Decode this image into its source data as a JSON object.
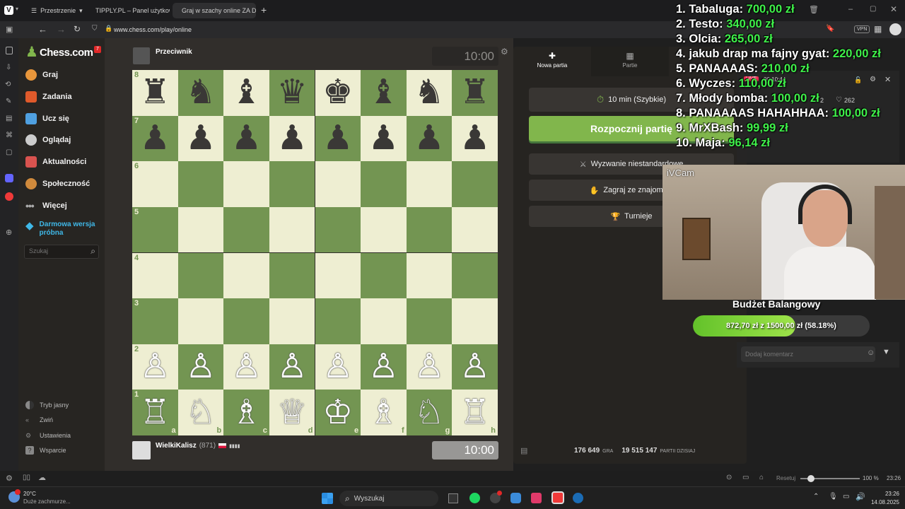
{
  "browser": {
    "spaces_label": "Przestrzenie",
    "tabs": [
      {
        "label": "TIPPLY.PL – Panel użytkown"
      },
      {
        "label": "Graj w szachy online ZA DA"
      }
    ],
    "url": "www.chess.com/play/online",
    "vpn": "VPN"
  },
  "sidebar": {
    "logo": "Chess.com",
    "notif_count": "7",
    "items": [
      {
        "label": "Graj",
        "color": "#e8963b"
      },
      {
        "label": "Zadania",
        "color": "#e05a2b"
      },
      {
        "label": "Ucz się",
        "color": "#4fa0e0"
      },
      {
        "label": "Oglądaj",
        "color": "#cccccc"
      },
      {
        "label": "Aktualności",
        "color": "#d9534f"
      },
      {
        "label": "Społeczność",
        "color": "#d08a3c"
      },
      {
        "label": "Więcej",
        "color": "#aaaaaa"
      }
    ],
    "premium": "Darmowa wersja próbna",
    "search_placeholder": "Szukaj",
    "bottom": [
      "Tryb jasny",
      "Zwiń",
      "Ustawienia",
      "Wsparcie"
    ]
  },
  "game": {
    "opponent_name": "Przeciwnik",
    "opponent_clock": "10:00",
    "player_name": "WielkiKalisz",
    "player_rating": "(871)",
    "player_clock": "10:00",
    "board": [
      [
        "♜",
        "♞",
        "♝",
        "♛",
        "♚",
        "♝",
        "♞",
        "♜"
      ],
      [
        "♟",
        "♟",
        "♟",
        "♟",
        "♟",
        "♟",
        "♟",
        "♟"
      ],
      [
        "",
        "",
        "",
        "",
        "",
        "",
        "",
        ""
      ],
      [
        "",
        "",
        "",
        "",
        "",
        "",
        "",
        ""
      ],
      [
        "",
        "",
        "",
        "",
        "",
        "",
        "",
        ""
      ],
      [
        "",
        "",
        "",
        "",
        "",
        "",
        "",
        ""
      ],
      [
        "♙",
        "♙",
        "♙",
        "♙",
        "♙",
        "♙",
        "♙",
        "♙"
      ],
      [
        "♖",
        "♘",
        "♗",
        "♕",
        "♔",
        "♗",
        "♘",
        "♖"
      ]
    ],
    "ranks": [
      "8",
      "7",
      "6",
      "5",
      "4",
      "3",
      "2",
      "1"
    ],
    "files": [
      "a",
      "b",
      "c",
      "d",
      "e",
      "f",
      "g",
      "h"
    ]
  },
  "panel": {
    "tab_new": "Nowa partia",
    "tab_games": "Partie",
    "time_control": "10 min (Szybkie)",
    "start": "Rozpocznij partię",
    "custom": "Wyzwanie niestandardowe",
    "friend": "Zagraj ze znajomym",
    "tournaments": "Turnieje",
    "games_count": "176 649",
    "games_label": "GRA",
    "players_count": "19 515 147",
    "players_label": "PARTII DZISIAJ"
  },
  "overlay": {
    "leaderboard": [
      {
        "rank": "1.",
        "name": "Tabaluga:",
        "amount": "700,00 zł"
      },
      {
        "rank": "2.",
        "name": "Testo:",
        "amount": "340,00 zł"
      },
      {
        "rank": "3.",
        "name": "Olcia:",
        "amount": "265,00 zł"
      },
      {
        "rank": "4.",
        "name": "jakub drap ma fajny gyat:",
        "amount": "220,00 zł"
      },
      {
        "rank": "5.",
        "name": "PANAAAAS:",
        "amount": "210,00 zł"
      },
      {
        "rank": "6.",
        "name": "Wyczes:",
        "amount": "110,00 zł"
      },
      {
        "rank": "7.",
        "name": "Młody bomba:",
        "amount": "100,00 zł"
      },
      {
        "rank": "8.",
        "name": "PANAAAAS HAHAHHAA:",
        "amount": "100,00 zł"
      },
      {
        "rank": "9.",
        "name": "MrXBash:",
        "amount": "99,99 zł"
      },
      {
        "rank": "10.",
        "name": "Maja:",
        "amount": "96,14 zł"
      }
    ],
    "live": "LIVE",
    "stream_time": "00:10:44",
    "likes": "262",
    "viewers": "2",
    "webcam_label": "iVCam",
    "budget_title": "Budżet Balangowy",
    "budget_text": "872,70 zł z 1500,00 zł (58.18%)",
    "budget_fraction": 0.5818,
    "comment_placeholder": "Dodaj komentarz"
  },
  "statusbar": {
    "reset": "Resetuj",
    "zoom": "100 %",
    "time": "23:26"
  },
  "taskbar": {
    "temp": "20°C",
    "weather": "Duże zachmurze...",
    "search": "Wyszukaj",
    "clock": "23:26",
    "date": "14.08.2025"
  }
}
